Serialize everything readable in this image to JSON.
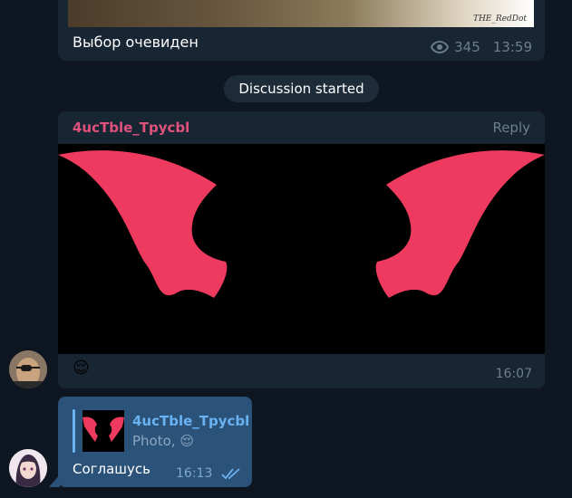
{
  "post": {
    "image_watermark": "THE_RedDot",
    "caption": "Выбор очевиден",
    "views": "345",
    "time": "13:59"
  },
  "service": {
    "label": "Discussion started"
  },
  "message1": {
    "sender": "4ucTble_Tpycbl",
    "reply_label": "Reply",
    "emoji": "😌",
    "time": "16:07",
    "sender_color": "#e0527c"
  },
  "message2": {
    "quote_name": "4ucTble_Tpycbl",
    "quote_text": "Photo, 😌",
    "text": "Соглашусь",
    "time": "16:13",
    "status_icon": "double-check-icon"
  },
  "colors": {
    "background": "#0e1621",
    "incoming_bubble": "#182533",
    "outgoing_bubble": "#2b5278",
    "wing_color": "#ee3a5e"
  }
}
